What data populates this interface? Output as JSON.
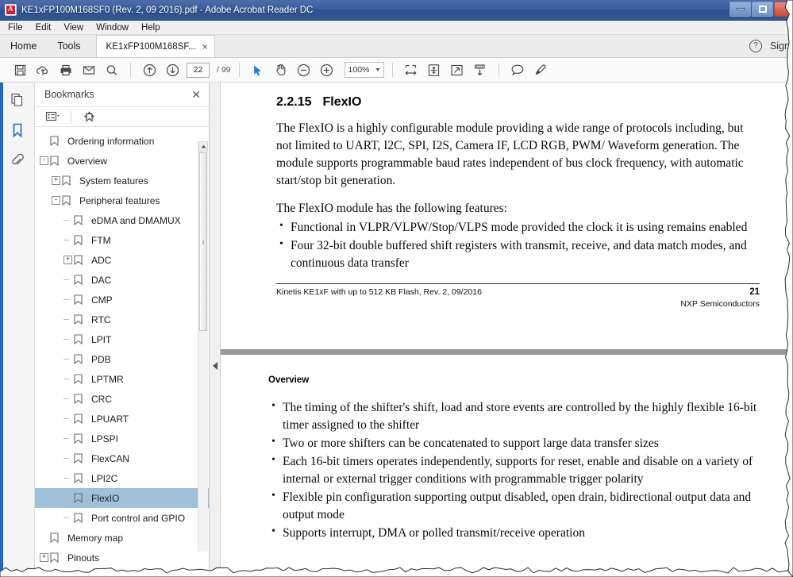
{
  "window": {
    "title": "KE1xFP100M168SF0 (Rev. 2, 09 2016).pdf - Adobe Acrobat Reader DC",
    "app_icon": "acrobat-icon",
    "minimize_label": "",
    "maximize_label": "",
    "close_label": ""
  },
  "menubar": {
    "items": [
      {
        "label": "File"
      },
      {
        "label": "Edit"
      },
      {
        "label": "View"
      },
      {
        "label": "Window"
      },
      {
        "label": "Help"
      }
    ]
  },
  "tabstrip": {
    "home_label": "Home",
    "tools_label": "Tools",
    "document_tab": "KE1xFP100M168SF...",
    "close_tab_label": "×",
    "help_label": "?",
    "signin_label": "Sign"
  },
  "toolbar": {
    "icons": [
      {
        "name": "save-icon"
      },
      {
        "name": "cloud-upload-icon"
      },
      {
        "name": "print-icon"
      },
      {
        "name": "email-icon"
      },
      {
        "name": "search-icon"
      }
    ],
    "prev_page_label": "previous-page",
    "next_page_label": "next-page",
    "page_number": "22",
    "page_total": "/ 99",
    "select_tool_label": "selection-tool",
    "hand_tool_label": "hand-tool",
    "zoom_out_label": "zoom-out",
    "zoom_in_label": "zoom-in",
    "zoom_level": "100%",
    "fit_width_label": "fit-width",
    "fit_page_label": "fit-page",
    "fullscreen_label": "fullscreen",
    "scroll_mode_label": "scroll-mode",
    "comment_label": "comment",
    "highlight_label": "highlight"
  },
  "rail": {
    "items": [
      {
        "name": "page-thumbnails-icon",
        "active": false
      },
      {
        "name": "bookmarks-icon",
        "active": true
      },
      {
        "name": "attachments-icon",
        "active": false
      }
    ]
  },
  "bookmarks_panel": {
    "title": "Bookmarks",
    "close_label": "✕",
    "options_label": "options-menu",
    "new_bookmark_label": "new-bookmark",
    "items": [
      {
        "label": "Ordering information",
        "depth": 0,
        "twisty": "",
        "selected": false
      },
      {
        "label": "Overview",
        "depth": 0,
        "twisty": "-",
        "selected": false
      },
      {
        "label": "System features",
        "depth": 1,
        "twisty": "+",
        "selected": false
      },
      {
        "label": "Peripheral features",
        "depth": 1,
        "twisty": "-",
        "selected": false
      },
      {
        "label": "eDMA and DMAMUX",
        "depth": 2,
        "twisty": "",
        "selected": false
      },
      {
        "label": "FTM",
        "depth": 2,
        "twisty": "",
        "selected": false
      },
      {
        "label": "ADC",
        "depth": 2,
        "twisty": "+",
        "selected": false
      },
      {
        "label": "DAC",
        "depth": 2,
        "twisty": "",
        "selected": false
      },
      {
        "label": "CMP",
        "depth": 2,
        "twisty": "",
        "selected": false
      },
      {
        "label": "RTC",
        "depth": 2,
        "twisty": "",
        "selected": false
      },
      {
        "label": "LPIT",
        "depth": 2,
        "twisty": "",
        "selected": false
      },
      {
        "label": "PDB",
        "depth": 2,
        "twisty": "",
        "selected": false
      },
      {
        "label": "LPTMR",
        "depth": 2,
        "twisty": "",
        "selected": false
      },
      {
        "label": "CRC",
        "depth": 2,
        "twisty": "",
        "selected": false
      },
      {
        "label": "LPUART",
        "depth": 2,
        "twisty": "",
        "selected": false
      },
      {
        "label": "LPSPI",
        "depth": 2,
        "twisty": "",
        "selected": false
      },
      {
        "label": "FlexCAN",
        "depth": 2,
        "twisty": "",
        "selected": false
      },
      {
        "label": "LPI2C",
        "depth": 2,
        "twisty": "",
        "selected": false
      },
      {
        "label": "FlexIO",
        "depth": 2,
        "twisty": "",
        "selected": true
      },
      {
        "label": "Port control and GPIO",
        "depth": 2,
        "twisty": "",
        "selected": false
      },
      {
        "label": "Memory map",
        "depth": 0,
        "twisty": "",
        "selected": false
      },
      {
        "label": "Pinouts",
        "depth": 0,
        "twisty": "+",
        "selected": false
      }
    ]
  },
  "document": {
    "page1": {
      "section_number": "2.2.15",
      "section_title": "FlexIO",
      "paragraph1": "The FlexIO is a highly configurable module providing a wide range of protocols including, but not limited to UART, I2C, SPI, I2S, Camera IF, LCD RGB, PWM/ Waveform generation. The module supports programmable baud rates independent of bus clock frequency, with automatic start/stop bit generation.",
      "paragraph2": "The FlexIO module has the following features:",
      "bullets": [
        "Functional in VLPR/VLPW/Stop/VLPS mode provided the clock it is using remains enabled",
        "Four 32-bit double buffered shift registers with transmit, receive, and data match modes, and continuous data transfer"
      ],
      "footer_left": "Kinetis KE1xF with up to 512 KB Flash, Rev. 2, 09/2016",
      "footer_page": "21",
      "footer_right": "NXP Semiconductors"
    },
    "page2": {
      "header": "Overview",
      "bullets": [
        "The timing of the shifter's shift, load and store events are controlled by the highly flexible 16-bit timer assigned to the shifter",
        "Two or more shifters can be concatenated to support large data transfer sizes",
        "Each 16-bit timers operates independently, supports for reset, enable and disable on a variety of internal or external trigger conditions with programmable trigger polarity",
        "Flexible pin configuration supporting output disabled, open drain, bidirectional output data and output mode",
        "Supports interrupt, DMA or polled transmit/receive operation"
      ]
    }
  },
  "colors": {
    "titlebar": "#2e5391",
    "accent": "#1b6ac9",
    "selection": "#9fc0d9",
    "acrobat_red": "#d81f26",
    "viewer_bg": "#7f7f7f"
  }
}
